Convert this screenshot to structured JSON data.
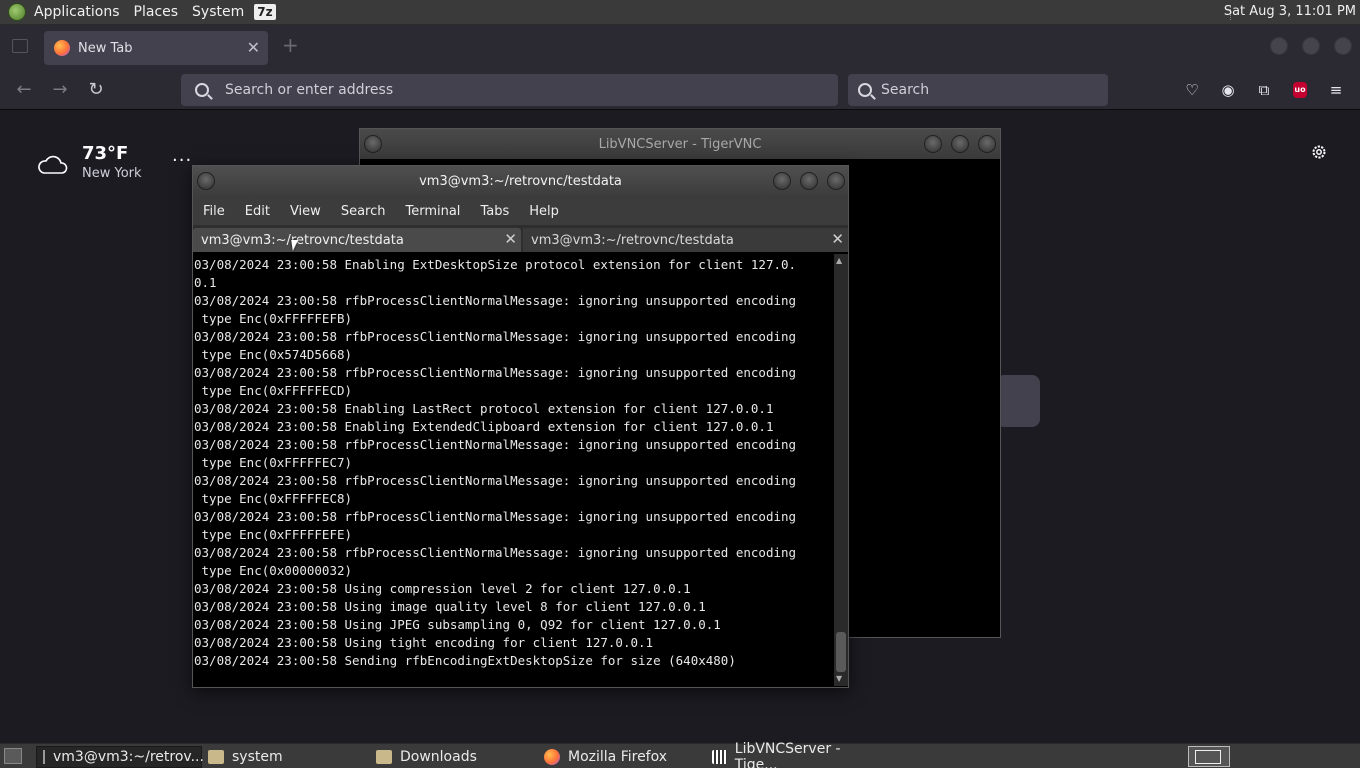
{
  "top_panel": {
    "menus": [
      "Applications",
      "Places",
      "System"
    ],
    "badge": "7z",
    "clock": "Sat Aug  3, 11:01 PM"
  },
  "firefox": {
    "tab": {
      "title": "New Tab",
      "close": "✕"
    },
    "new_tab_symbol": "+",
    "urlbar_placeholder": "Search or enter address",
    "searchbar_placeholder": "Search",
    "ublock_label": "uo"
  },
  "newtab": {
    "weather": {
      "temp": "73°F",
      "city": "New York",
      "menu": "···"
    }
  },
  "vnc_window": {
    "title": "LibVNCServer - TigerVNC"
  },
  "terminal": {
    "title": "vm3@vm3:~/retrovnc/testdata",
    "menus": [
      "File",
      "Edit",
      "View",
      "Search",
      "Terminal",
      "Tabs",
      "Help"
    ],
    "tabs": [
      "vm3@vm3:~/retrovnc/testdata",
      "vm3@vm3:~/retrovnc/testdata"
    ],
    "tab_close": "✕",
    "lines": [
      "03/08/2024 23:00:58 Enabling ExtDesktopSize protocol extension for client 127.0.",
      "0.1",
      "03/08/2024 23:00:58 rfbProcessClientNormalMessage: ignoring unsupported encoding",
      " type Enc(0xFFFFFEFB)",
      "03/08/2024 23:00:58 rfbProcessClientNormalMessage: ignoring unsupported encoding",
      " type Enc(0x574D5668)",
      "03/08/2024 23:00:58 rfbProcessClientNormalMessage: ignoring unsupported encoding",
      " type Enc(0xFFFFFECD)",
      "03/08/2024 23:00:58 Enabling LastRect protocol extension for client 127.0.0.1",
      "03/08/2024 23:00:58 Enabling ExtendedClipboard extension for client 127.0.0.1",
      "03/08/2024 23:00:58 rfbProcessClientNormalMessage: ignoring unsupported encoding",
      " type Enc(0xFFFFFEC7)",
      "03/08/2024 23:00:58 rfbProcessClientNormalMessage: ignoring unsupported encoding",
      " type Enc(0xFFFFFEC8)",
      "03/08/2024 23:00:58 rfbProcessClientNormalMessage: ignoring unsupported encoding",
      " type Enc(0xFFFFFEFE)",
      "03/08/2024 23:00:58 rfbProcessClientNormalMessage: ignoring unsupported encoding",
      " type Enc(0x00000032)",
      "03/08/2024 23:00:58 Using compression level 2 for client 127.0.0.1",
      "03/08/2024 23:00:58 Using image quality level 8 for client 127.0.0.1",
      "03/08/2024 23:00:58 Using JPEG subsampling 0, Q92 for client 127.0.0.1",
      "03/08/2024 23:00:58 Using tight encoding for client 127.0.0.1",
      "03/08/2024 23:00:58 Sending rfbEncodingExtDesktopSize for size (640x480)"
    ]
  },
  "taskbar": {
    "tasks": [
      {
        "label": "vm3@vm3:~/retrov...",
        "icon": "terminal-icon"
      },
      {
        "label": "system",
        "icon": "folder-icon"
      },
      {
        "label": "Downloads",
        "icon": "folder-icon"
      },
      {
        "label": "Mozilla Firefox",
        "icon": "firefox-icon"
      },
      {
        "label": "LibVNCServer - Tige...",
        "icon": "vnc-icon"
      }
    ]
  }
}
